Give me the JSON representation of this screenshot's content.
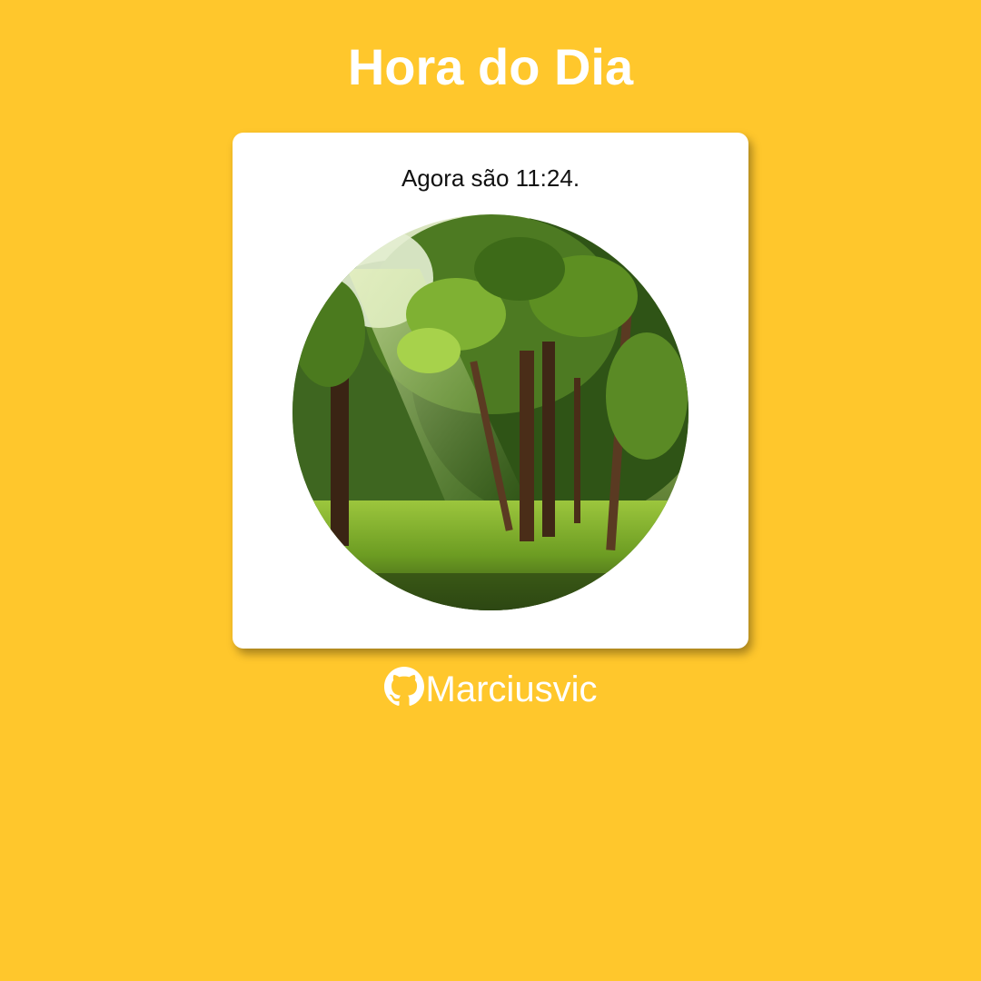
{
  "page": {
    "title": "Hora do Dia",
    "background_color": "#FFC72C"
  },
  "card": {
    "message": "Agora são 11:24.",
    "image": {
      "subject": "sunlit forest with tall trees and green grass",
      "shape": "circle"
    }
  },
  "footer": {
    "link_icon": "github-icon",
    "link_text": "Marciusvic"
  }
}
